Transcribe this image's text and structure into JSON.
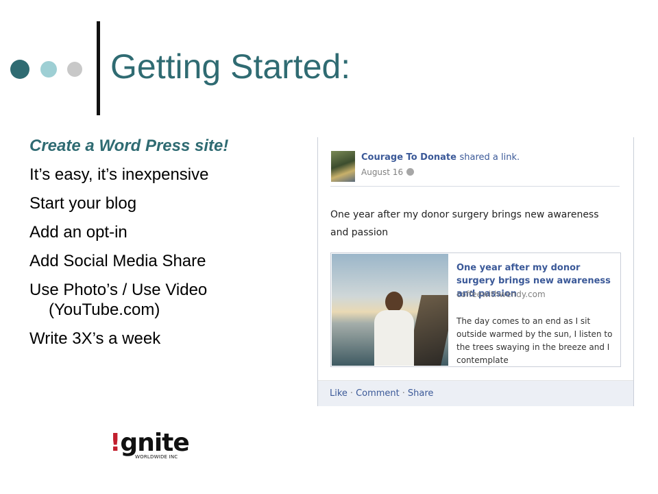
{
  "slide": {
    "title": "Getting Started:",
    "colors": {
      "title": "#2f6b72",
      "dot_1": "#2f6b72",
      "dot_2": "#9ecfd4",
      "dot_3": "#c8c8c8",
      "rule": "#111111"
    }
  },
  "bullets": [
    "Create a Word Press site!",
    "It’s easy, it’s inexpensive",
    "Start your blog",
    "Add an opt-in",
    "Add Social Media Share",
    "Use Photo’s / Use Video (YouTube.com)",
    "Write 3X’s a week"
  ],
  "facebook_post": {
    "page_name": "Courage To Donate",
    "action": "shared a link.",
    "date": "August 16",
    "message": "One year after my donor surgery brings new awareness and passion",
    "link": {
      "title": "One year after my donor surgery brings new awareness and passion",
      "domain": "coffeewithwendy.com",
      "description": "The day comes to an end as I sit outside warmed by the sun, I listen to the trees swaying in the breeze and I contemplate"
    },
    "footer": {
      "like": "Like",
      "comment": "Comment",
      "share": "Share",
      "separator": "·"
    },
    "colors": {
      "link": "#3b5998",
      "footer_bg": "#eceff5"
    }
  },
  "logo": {
    "bang": "!",
    "word": "gnite",
    "sub": "WORLDWIDE INC"
  }
}
